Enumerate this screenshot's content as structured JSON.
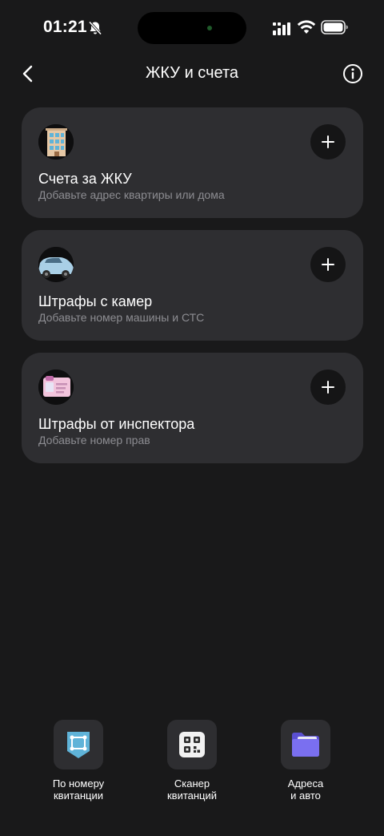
{
  "status_bar": {
    "time": "01:21"
  },
  "header": {
    "title": "ЖКУ и счета"
  },
  "cards": [
    {
      "title": "Счета за ЖКУ",
      "subtitle": "Добавьте адрес квартиры или дома",
      "icon": "building-icon"
    },
    {
      "title": "Штрафы с камер",
      "subtitle": "Добавьте номер машины и СТС",
      "icon": "car-icon"
    },
    {
      "title": "Штрафы от инспектора",
      "subtitle": "Добавьте номер прав",
      "icon": "license-icon"
    }
  ],
  "bottom_actions": [
    {
      "line1": "По номеру",
      "line2": "квитанции",
      "icon": "receipt-number-icon"
    },
    {
      "line1": "Сканер",
      "line2": "квитанций",
      "icon": "qr-scanner-icon"
    },
    {
      "line1": "Адреса",
      "line2": "и авто",
      "icon": "folder-icon"
    }
  ],
  "colors": {
    "background": "#19191a",
    "card": "#2e2e31",
    "subtitle": "#8d8d92",
    "accent_purple": "#7a6ff0",
    "accent_blue": "#5fb3d8"
  }
}
